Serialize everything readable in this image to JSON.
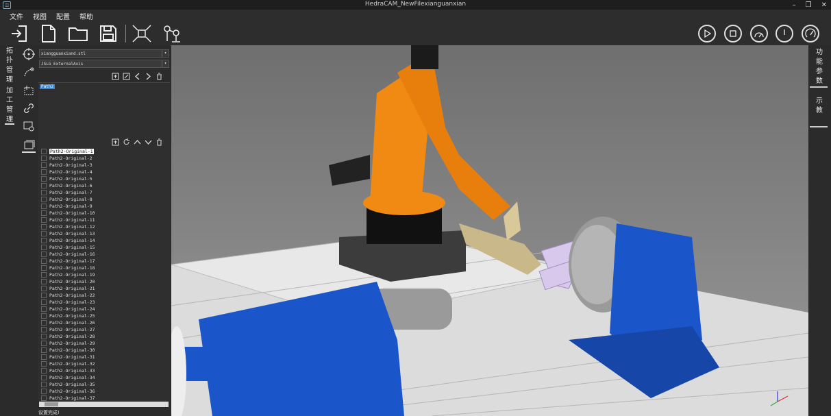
{
  "window": {
    "title": "HedraCAM_NewFilexianguanxian",
    "app_icon": "app-logo-icon"
  },
  "menu": [
    "文件",
    "视图",
    "配置",
    "帮助"
  ],
  "toolbar": {
    "icons": [
      "import-icon",
      "new-file-icon",
      "open-folder-icon",
      "save-icon",
      "fit-view-icon",
      "robot-teach-icon"
    ]
  },
  "sim_controls": [
    "play-icon",
    "stop-icon",
    "speed-gauge-icon",
    "clock-icon",
    "dashboard-icon"
  ],
  "left_tabs": [
    {
      "label": "拓扑管理"
    },
    {
      "label": "加工管理"
    }
  ],
  "panel": {
    "model_file": "xiangguanxiand.stl",
    "axis_config": "JSLG ExternalAxis",
    "path_tag": "Path2",
    "path_items": [
      "Path2-Original-1",
      "Path2-Original-2",
      "Path2-Original-3",
      "Path2-Original-4",
      "Path2-Original-5",
      "Path2-Original-6",
      "Path2-Original-7",
      "Path2-Original-8",
      "Path2-Original-9",
      "Path2-Original-10",
      "Path2-Original-11",
      "Path2-Original-12",
      "Path2-Original-13",
      "Path2-Original-14",
      "Path2-Original-15",
      "Path2-Original-16",
      "Path2-Original-17",
      "Path2-Original-18",
      "Path2-Original-19",
      "Path2-Original-20",
      "Path2-Original-21",
      "Path2-Original-22",
      "Path2-Original-23",
      "Path2-Original-24",
      "Path2-Original-25",
      "Path2-Original-26",
      "Path2-Original-27",
      "Path2-Original-28",
      "Path2-Original-29",
      "Path2-Original-30",
      "Path2-Original-31",
      "Path2-Original-32",
      "Path2-Original-33",
      "Path2-Original-34",
      "Path2-Original-35",
      "Path2-Original-36",
      "Path2-Original-37"
    ],
    "selected_index": 0,
    "status": "设置完成!"
  },
  "right_tabs": [
    {
      "label": "功能参数"
    },
    {
      "label": "示教"
    }
  ],
  "colors": {
    "robot": "#f08a12",
    "positioner": "#1a56c9",
    "workpiece": "#d7c8ec",
    "accent": "#3a86d6"
  }
}
